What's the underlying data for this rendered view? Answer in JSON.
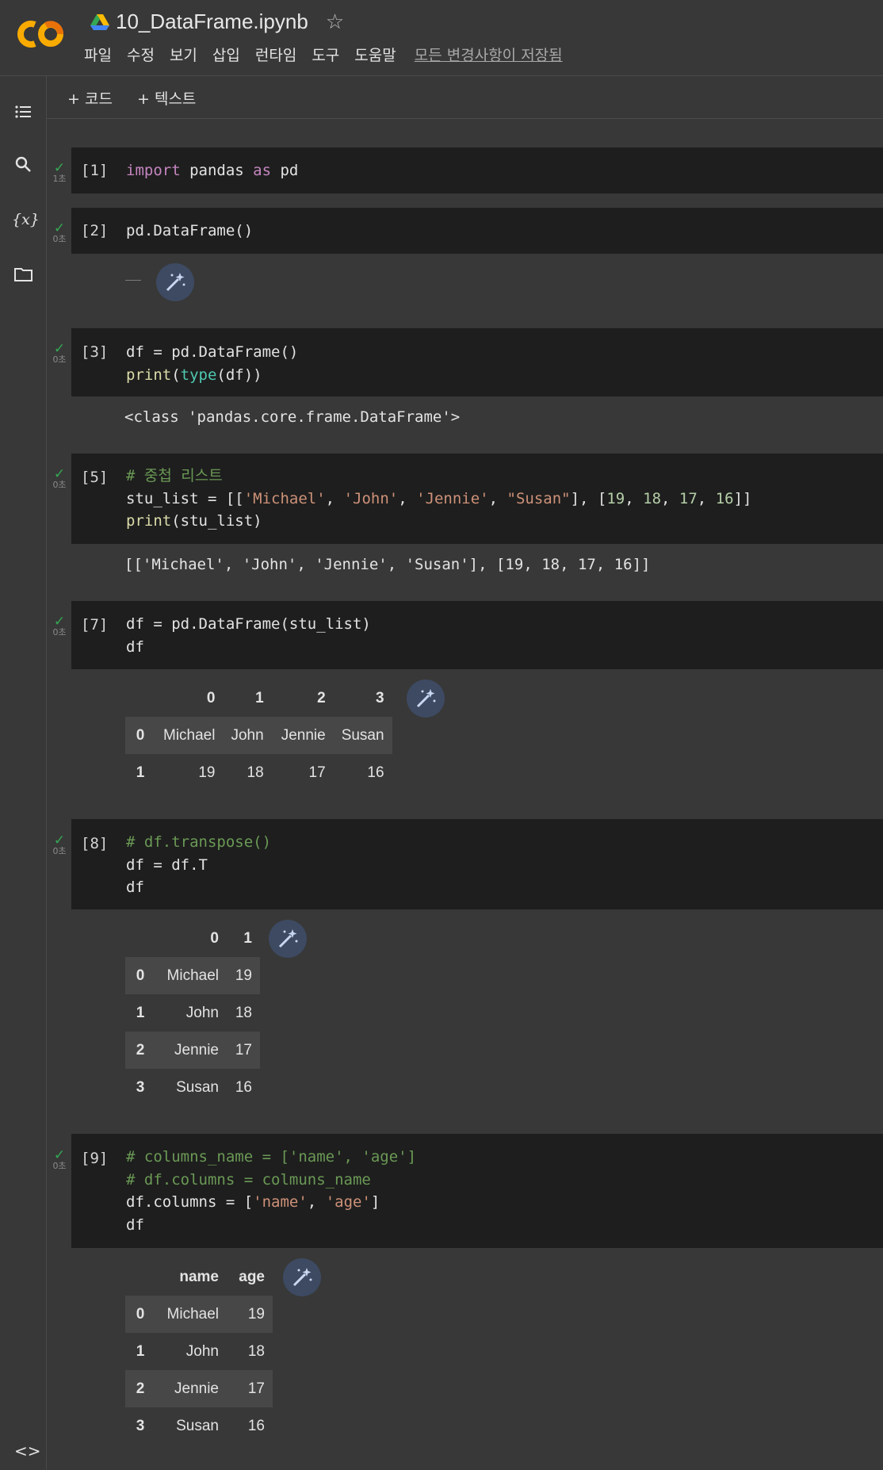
{
  "app": {
    "title": "10_DataFrame.ipynb",
    "menu": [
      "파일",
      "수정",
      "보기",
      "삽입",
      "런타임",
      "도구",
      "도움말"
    ],
    "saved_status": "모든 변경사항이 저장됨"
  },
  "toolbar": {
    "add_code": "+ 코드",
    "add_text": "+ 텍스트"
  },
  "cells": [
    {
      "exec": "[1]",
      "time": "1초",
      "code_lines": [
        "import pandas as pd"
      ]
    },
    {
      "exec": "[2]",
      "time": "0초",
      "code_lines": [
        "pd.DataFrame()"
      ],
      "output": "—"
    },
    {
      "exec": "[3]",
      "time": "0초",
      "code_lines": [
        "df = pd.DataFrame()",
        "print(type(df))"
      ],
      "output": "<class 'pandas.core.frame.DataFrame'>"
    },
    {
      "exec": "[5]",
      "time": "0초",
      "code_lines": [
        "# 중첩 리스트",
        "stu_list = [['Michael', 'John', 'Jennie', \"Susan\"], [19, 18, 17, 16]]",
        "print(stu_list)"
      ],
      "output": "[['Michael', 'John', 'Jennie', 'Susan'], [19, 18, 17, 16]]"
    },
    {
      "exec": "[7]",
      "time": "0초",
      "code_lines": [
        "df = pd.DataFrame(stu_list)",
        "df"
      ],
      "table": {
        "columns": [
          "0",
          "1",
          "2",
          "3"
        ],
        "rows": [
          {
            "index": "0",
            "values": [
              "Michael",
              "John",
              "Jennie",
              "Susan"
            ]
          },
          {
            "index": "1",
            "values": [
              "19",
              "18",
              "17",
              "16"
            ]
          }
        ]
      }
    },
    {
      "exec": "[8]",
      "time": "0초",
      "code_lines": [
        "# df.transpose()",
        "df = df.T",
        "df"
      ],
      "table": {
        "columns": [
          "0",
          "1"
        ],
        "rows": [
          {
            "index": "0",
            "values": [
              "Michael",
              "19"
            ]
          },
          {
            "index": "1",
            "values": [
              "John",
              "18"
            ]
          },
          {
            "index": "2",
            "values": [
              "Jennie",
              "17"
            ]
          },
          {
            "index": "3",
            "values": [
              "Susan",
              "16"
            ]
          }
        ]
      }
    },
    {
      "exec": "[9]",
      "time": "0초",
      "code_lines": [
        "# columns_name = ['name', 'age']",
        "# df.columns = colmuns_name",
        "df.columns = ['name', 'age']",
        "df"
      ],
      "table": {
        "columns": [
          "name",
          "age"
        ],
        "rows": [
          {
            "index": "0",
            "values": [
              "Michael",
              "19"
            ]
          },
          {
            "index": "1",
            "values": [
              "John",
              "18"
            ]
          },
          {
            "index": "2",
            "values": [
              "Jennie",
              "17"
            ]
          },
          {
            "index": "3",
            "values": [
              "Susan",
              "16"
            ]
          }
        ]
      }
    }
  ],
  "status_icon": "checkmark-icon",
  "colors": {
    "accent_check": "#34a853",
    "background": "#383838",
    "cell_bg": "#1e1e1e"
  }
}
